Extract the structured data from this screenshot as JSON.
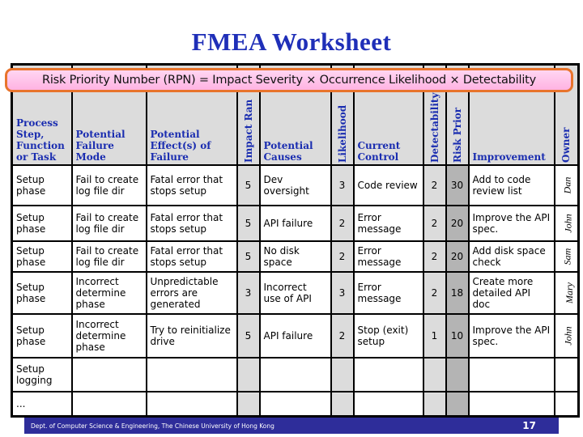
{
  "slide": {
    "title": "FMEA Worksheet",
    "banner": "Risk Priority Number (RPN) = Impact Severity × Occurrence Likelihood × Detectability",
    "footer_text": "Dept. of Computer Science & Engineering, The Chinese University of Hong Kong",
    "page_number": "17",
    "colors": {
      "title": "#1f2fb8",
      "header_text": "#1a2db0",
      "banner_fill": "#ffc4ea",
      "banner_border": "#e8742c",
      "footer_bg": "#2e2d9a",
      "rating_fill": "#dcdcdc",
      "rpn_fill": "#b4b4b4"
    }
  },
  "table": {
    "headers": [
      "Process Step, Function or Task",
      "Potential Failure Mode",
      "Potential Effect(s) of Failure",
      "Impact Ran",
      "Potential Causes",
      "Likelihood",
      "Current Control",
      "Detectability",
      "Risk Prior",
      "Improvement",
      "Owner"
    ],
    "rows": [
      [
        "Setup phase",
        "Fail to create log file dir",
        "Fatal error that stops setup",
        "5",
        "Dev oversight",
        "3",
        "Code review",
        "2",
        "30",
        "Add to code review list",
        "Dan"
      ],
      [
        "Setup phase",
        "Fail to create log file dir",
        "Fatal error that stops setup",
        "5",
        "API failure",
        "2",
        "Error message",
        "2",
        "20",
        "Improve the API spec.",
        "John"
      ],
      [
        "Setup phase",
        "Fail to create log file dir",
        "Fatal error that stops setup",
        "5",
        "No disk space",
        "2",
        "Error message",
        "2",
        "20",
        "Add disk space check",
        "Sam"
      ],
      [
        "Setup phase",
        "Incorrect determine phase",
        "Unpredictable errors are generated",
        "3",
        "Incorrect use of API",
        "3",
        "Error message",
        "2",
        "18",
        "Create more detailed API doc",
        "Mary"
      ],
      [
        "Setup phase",
        "Incorrect determine phase",
        "Try to reinitialize drive",
        "5",
        "API failure",
        "2",
        "Stop (exit) setup",
        "1",
        "10",
        "Improve the API spec.",
        "John"
      ],
      [
        "Setup logging",
        "",
        "",
        "",
        "",
        "",
        "",
        "",
        "",
        "",
        ""
      ],
      [
        "...",
        "",
        "",
        "",
        "",
        "",
        "",
        "",
        "",
        "",
        ""
      ]
    ]
  }
}
